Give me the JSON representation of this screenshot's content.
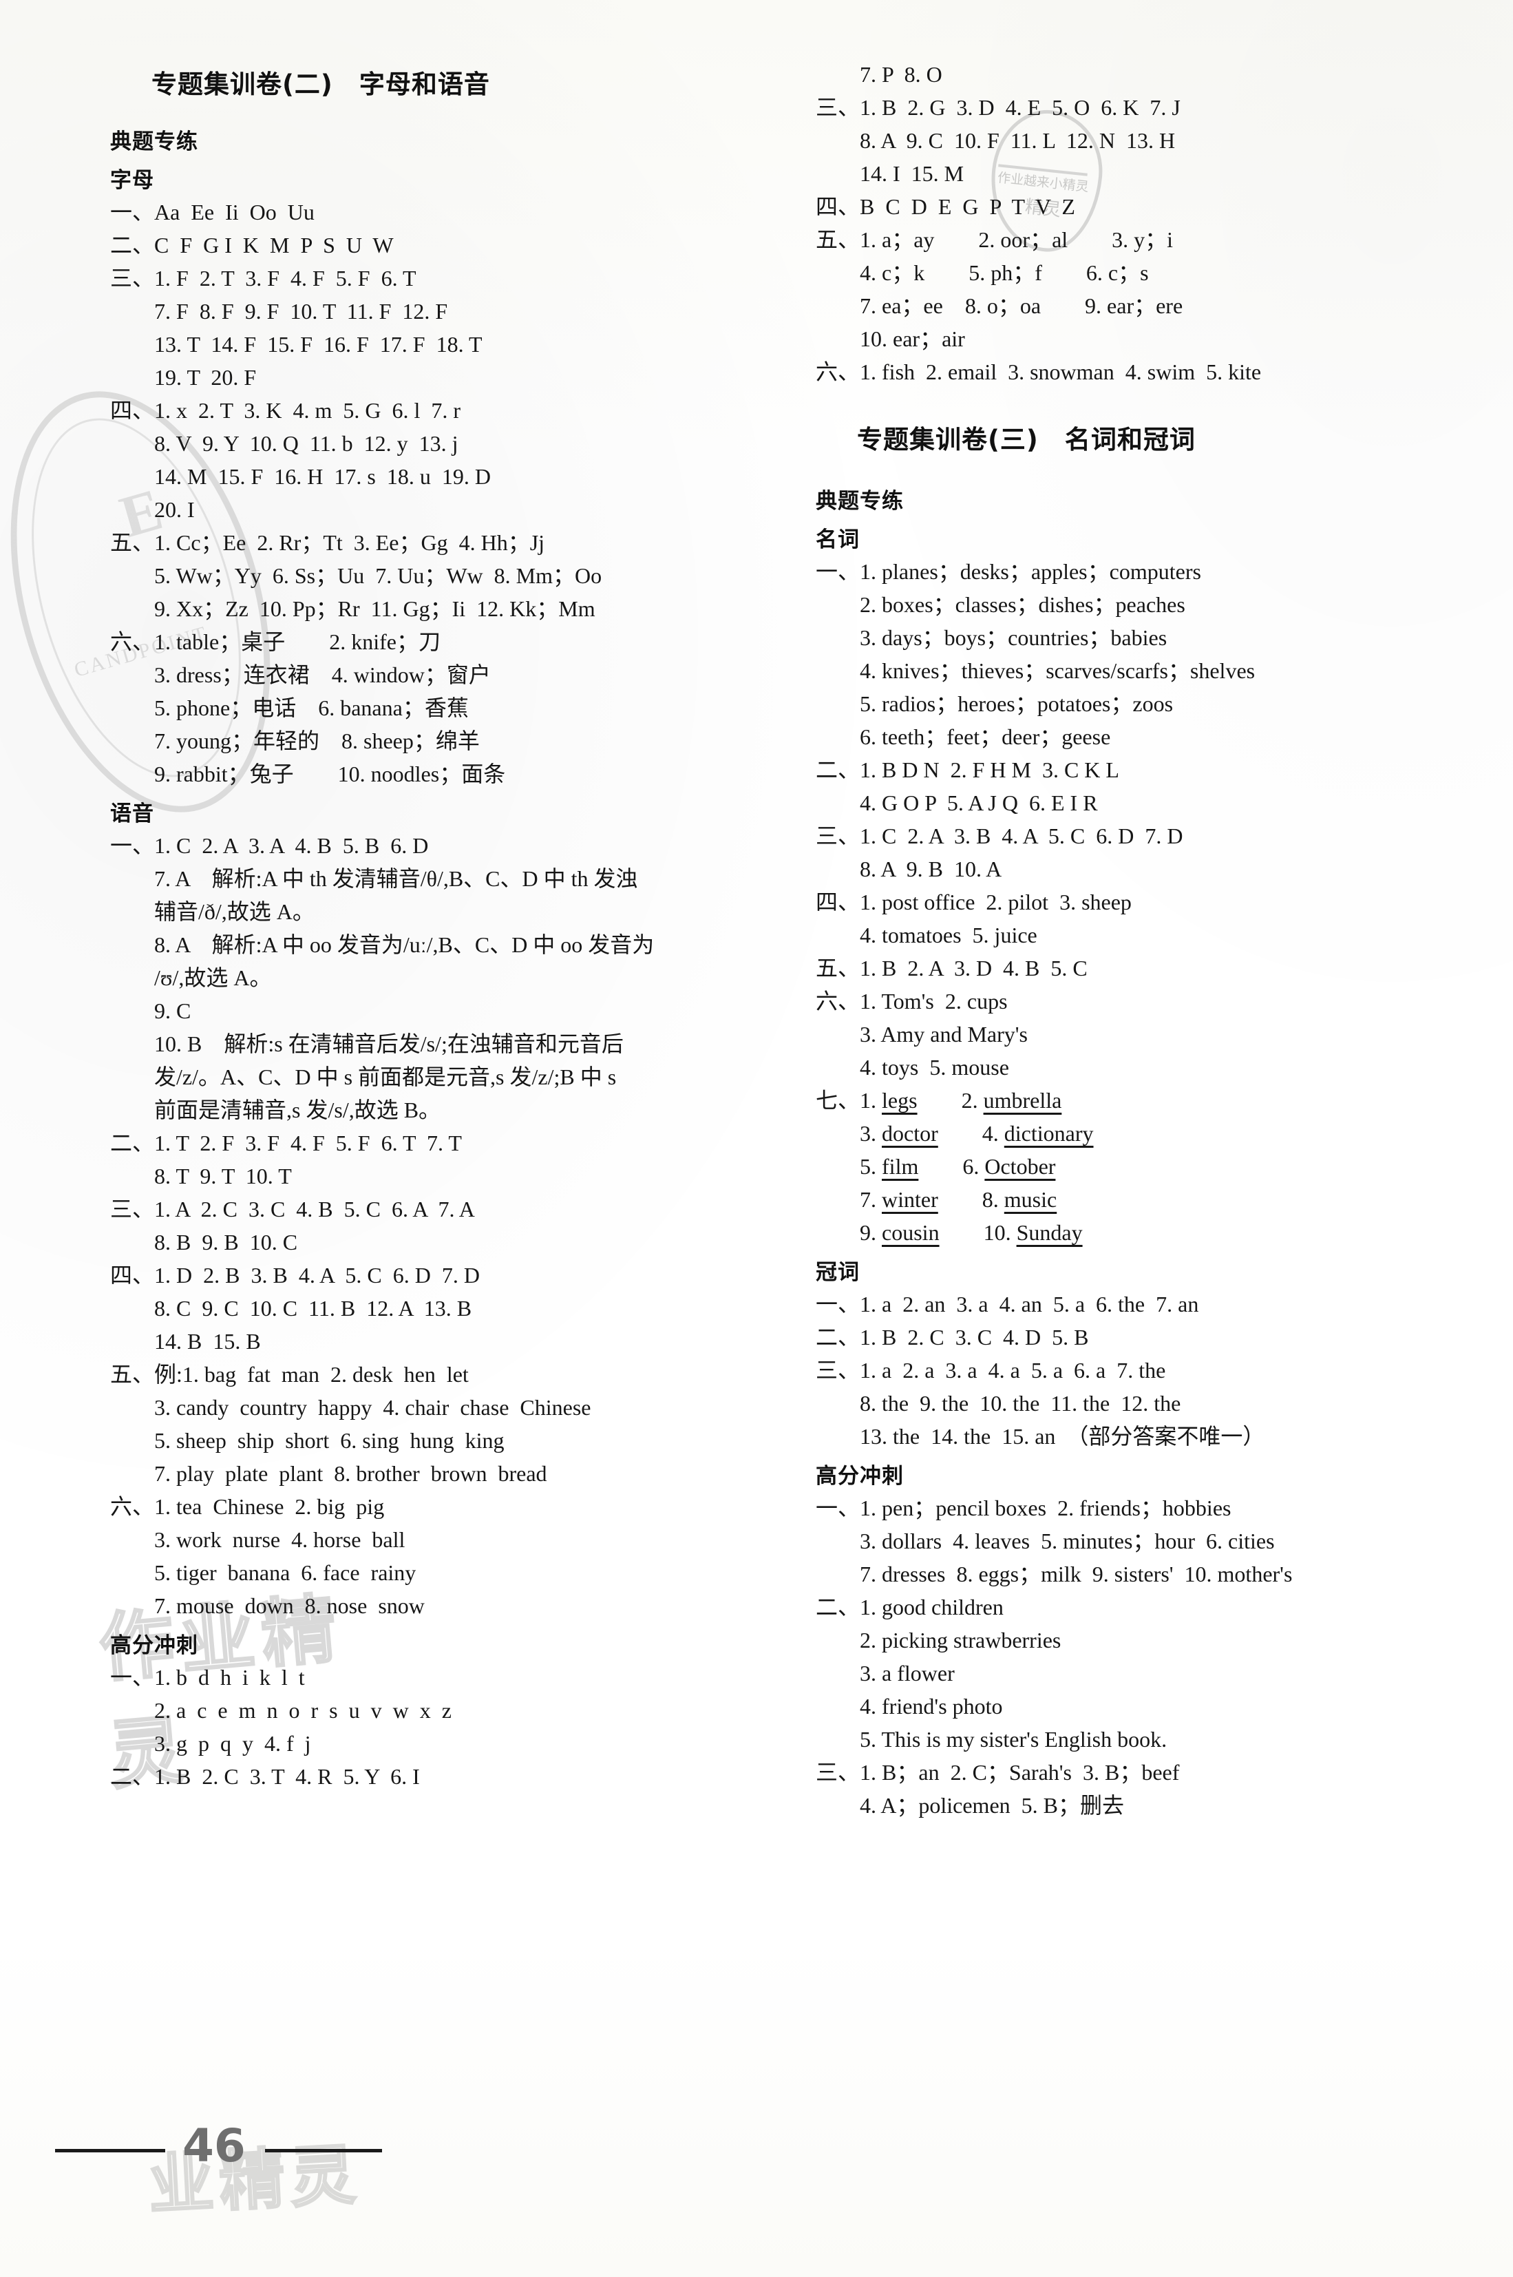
{
  "page": {
    "number": "46",
    "watermarks": {
      "left_stamp_big": "E",
      "left_stamp_small": "CANDPOINT",
      "center_text": "作业精灵",
      "right_stamp_line1": "作业越来小精灵",
      "right_stamp_line2": "精灵",
      "footer_text": "业精灵"
    }
  },
  "left_column": {
    "title": "专题集训卷(二)　字母和语音",
    "blocks": [
      {
        "type": "head",
        "text": "典题专练"
      },
      {
        "type": "head",
        "text": "字母"
      },
      {
        "type": "line",
        "num": "一、",
        "text": "Aa  Ee  Ii  Oo  Uu"
      },
      {
        "type": "line",
        "num": "二、",
        "text": "C  F  G I  K  M  P  S  U  W"
      },
      {
        "type": "line",
        "num": "三、",
        "text": "1. F  2. T  3. F  4. F  5. F  6. T"
      },
      {
        "type": "line",
        "num": "",
        "text": "7. F  8. F  9. F  10. T  11. F  12. F"
      },
      {
        "type": "line",
        "num": "",
        "text": "13. T  14. F  15. F  16. F  17. F  18. T"
      },
      {
        "type": "line",
        "num": "",
        "text": "19. T  20. F"
      },
      {
        "type": "line",
        "num": "四、",
        "text": "1. x  2. T  3. K  4. m  5. G  6. l  7. r"
      },
      {
        "type": "line",
        "num": "",
        "text": "8. V  9. Y  10. Q  11. b  12. y  13. j"
      },
      {
        "type": "line",
        "num": "",
        "text": "14. M  15. F  16. H  17. s  18. u  19. D"
      },
      {
        "type": "line",
        "num": "",
        "text": "20. I"
      },
      {
        "type": "line",
        "num": "五、",
        "text": "1. Cc；Ee  2. Rr；Tt  3. Ee；Gg  4. Hh；Jj"
      },
      {
        "type": "line",
        "num": "",
        "text": "5. Ww；Yy  6. Ss；Uu  7. Uu；Ww  8. Mm；Oo"
      },
      {
        "type": "line",
        "num": "",
        "text": "9. Xx；Zz  10. Pp；Rr  11. Gg；Ii  12. Kk；Mm"
      },
      {
        "type": "line",
        "num": "六、",
        "text": "1. table；桌子　　2. knife；刀"
      },
      {
        "type": "line",
        "num": "",
        "text": "3. dress；连衣裙　4. window；窗户"
      },
      {
        "type": "line",
        "num": "",
        "text": "5. phone；电话　6. banana；香蕉"
      },
      {
        "type": "line",
        "num": "",
        "text": "7. young；年轻的　8. sheep；绵羊"
      },
      {
        "type": "line",
        "num": "",
        "text": "9. rabbit；兔子　　10. noodles；面条"
      },
      {
        "type": "head",
        "text": "语音"
      },
      {
        "type": "line",
        "num": "一、",
        "text": "1. C  2. A  3. A  4. B  5. B  6. D"
      },
      {
        "type": "line",
        "num": "",
        "text": "7. A　解析:A 中 th 发清辅音/θ/,B、C、D 中 th 发浊"
      },
      {
        "type": "line",
        "num": "",
        "text": "辅音/ð/,故选 A。"
      },
      {
        "type": "line",
        "num": "",
        "text": "8. A　解析:A 中 oo 发音为/uː/,B、C、D 中 oo 发音为"
      },
      {
        "type": "line",
        "num": "",
        "text": "/ʊ/,故选 A。"
      },
      {
        "type": "line",
        "num": "",
        "text": "9. C"
      },
      {
        "type": "line",
        "num": "",
        "text": "10. B　解析:s 在清辅音后发/s/;在浊辅音和元音后"
      },
      {
        "type": "line",
        "num": "",
        "text": "发/z/。A、C、D 中 s 前面都是元音,s 发/z/;B 中 s"
      },
      {
        "type": "line",
        "num": "",
        "text": "前面是清辅音,s 发/s/,故选 B。"
      },
      {
        "type": "line",
        "num": "二、",
        "text": "1. T  2. F  3. F  4. F  5. F  6. T  7. T"
      },
      {
        "type": "line",
        "num": "",
        "text": "8. T  9. T  10. T"
      },
      {
        "type": "line",
        "num": "三、",
        "text": "1. A  2. C  3. C  4. B  5. C  6. A  7. A"
      },
      {
        "type": "line",
        "num": "",
        "text": "8. B  9. B  10. C"
      },
      {
        "type": "line",
        "num": "四、",
        "text": "1. D  2. B  3. B  4. A  5. C  6. D  7. D"
      },
      {
        "type": "line",
        "num": "",
        "text": "8. C  9. C  10. C  11. B  12. A  13. B"
      },
      {
        "type": "line",
        "num": "",
        "text": "14. B  15. B"
      },
      {
        "type": "line",
        "num": "五、",
        "text": "例:1. bag  fat  man  2. desk  hen  let"
      },
      {
        "type": "line",
        "num": "",
        "text": "3. candy  country  happy  4. chair  chase  Chinese"
      },
      {
        "type": "line",
        "num": "",
        "text": "5. sheep  ship  short  6. sing  hung  king"
      },
      {
        "type": "line",
        "num": "",
        "text": "7. play  plate  plant  8. brother  brown  bread"
      },
      {
        "type": "line",
        "num": "六、",
        "text": "1. tea  Chinese  2. big  pig"
      },
      {
        "type": "line",
        "num": "",
        "text": "3. work  nurse  4. horse  ball"
      },
      {
        "type": "line",
        "num": "",
        "text": "5. tiger  banana  6. face  rainy"
      },
      {
        "type": "line",
        "num": "",
        "text": "7. mouse  down  8. nose  snow"
      },
      {
        "type": "head",
        "text": "高分冲刺"
      },
      {
        "type": "line",
        "num": "一、",
        "text": "1. b  d  h  i  k  l  t"
      },
      {
        "type": "line",
        "num": "",
        "text": "2. a  c  e  m  n  o  r  s  u  v  w  x  z"
      },
      {
        "type": "line",
        "num": "",
        "text": "3. g  p  q  y  4. f  j"
      },
      {
        "type": "line",
        "num": "二、",
        "text": "1. B  2. C  3. T  4. R  5. Y  6. I"
      }
    ]
  },
  "right_column": {
    "title": "专题集训卷(三)　名词和冠词",
    "blocks_before_title": [
      {
        "type": "line",
        "num": "",
        "text": "7. P  8. O"
      },
      {
        "type": "line",
        "num": "三、",
        "text": "1. B  2. G  3. D  4. E  5. O  6. K  7. J"
      },
      {
        "type": "line",
        "num": "",
        "text": "8. A  9. C  10. F  11. L  12. N  13. H"
      },
      {
        "type": "line",
        "num": "",
        "text": "14. I  15. M"
      },
      {
        "type": "line",
        "num": "四、",
        "text": "B  C  D  E  G  P  T  V  Z"
      },
      {
        "type": "line",
        "num": "五、",
        "text": "1. a；ay　　2. oor；al　　3. y；i"
      },
      {
        "type": "line",
        "num": "",
        "text": "4. c；k　　5. ph；f　　6. c；s"
      },
      {
        "type": "line",
        "num": "",
        "text": "7. ea；ee　8. o；oa　　9. ear；ere"
      },
      {
        "type": "line",
        "num": "",
        "text": "10. ear；air"
      },
      {
        "type": "line",
        "num": "六、",
        "text": "1. fish  2. email  3. snowman  4. swim  5. kite"
      }
    ],
    "blocks_after_title": [
      {
        "type": "head",
        "text": "典题专练"
      },
      {
        "type": "head",
        "text": "名词"
      },
      {
        "type": "line",
        "num": "一、",
        "text": "1. planes；desks；apples；computers"
      },
      {
        "type": "line",
        "num": "",
        "text": "2. boxes；classes；dishes；peaches"
      },
      {
        "type": "line",
        "num": "",
        "text": "3. days；boys；countries；babies"
      },
      {
        "type": "line",
        "num": "",
        "text": "4. knives；thieves；scarves/scarfs；shelves"
      },
      {
        "type": "line",
        "num": "",
        "text": "5. radios；heroes；potatoes；zoos"
      },
      {
        "type": "line",
        "num": "",
        "text": "6. teeth；feet；deer；geese"
      },
      {
        "type": "line",
        "num": "二、",
        "text": "1. B D N  2. F H M  3. C K L"
      },
      {
        "type": "line",
        "num": "",
        "text": "4. G O P  5. A J Q  6. E I R"
      },
      {
        "type": "line",
        "num": "三、",
        "text": "1. C  2. A  3. B  4. A  5. C  6. D  7. D"
      },
      {
        "type": "line",
        "num": "",
        "text": "8. A  9. B  10. A"
      },
      {
        "type": "line",
        "num": "四、",
        "text": "1. post office  2. pilot  3. sheep"
      },
      {
        "type": "line",
        "num": "",
        "text": "4. tomatoes  5. juice"
      },
      {
        "type": "line",
        "num": "五、",
        "text": "1. B  2. A  3. D  4. B  5. C"
      },
      {
        "type": "line",
        "num": "六、",
        "text": "1. Tom's  2. cups"
      },
      {
        "type": "line",
        "num": "",
        "text": "3. Amy and Mary's"
      },
      {
        "type": "line",
        "num": "",
        "text": "4. toys  5. mouse"
      },
      {
        "type": "line_ul",
        "num": "七、",
        "pre": "1. ",
        "u1": "legs",
        "mid": "　　2. ",
        "u2": "umbrella"
      },
      {
        "type": "line_ul",
        "num": "",
        "pre": "3. ",
        "u1": "doctor",
        "mid": "　　4. ",
        "u2": "dictionary"
      },
      {
        "type": "line_ul",
        "num": "",
        "pre": "5. ",
        "u1": "film",
        "mid": "　　6. ",
        "u2": "October"
      },
      {
        "type": "line_ul",
        "num": "",
        "pre": "7. ",
        "u1": "winter",
        "mid": "　　8. ",
        "u2": "music"
      },
      {
        "type": "line_ul",
        "num": "",
        "pre": "9. ",
        "u1": "cousin",
        "mid": "　　10. ",
        "u2": "Sunday"
      },
      {
        "type": "head",
        "text": "冠词"
      },
      {
        "type": "line",
        "num": "一、",
        "text": "1. a  2. an  3. a  4. an  5. a  6. the  7. an"
      },
      {
        "type": "line",
        "num": "二、",
        "text": "1. B  2. C  3. C  4. D  5. B"
      },
      {
        "type": "line",
        "num": "三、",
        "text": "1. a  2. a  3. a  4. a  5. a  6. a  7. the"
      },
      {
        "type": "line",
        "num": "",
        "text": "8. the  9. the  10. the  11. the  12. the"
      },
      {
        "type": "line",
        "num": "",
        "text": "13. the  14. the  15. an　（部分答案不唯一）"
      },
      {
        "type": "head",
        "text": "高分冲刺"
      },
      {
        "type": "line",
        "num": "一、",
        "text": "1. pen；pencil boxes  2. friends；hobbies"
      },
      {
        "type": "line",
        "num": "",
        "text": "3. dollars  4. leaves  5. minutes；hour  6. cities"
      },
      {
        "type": "line",
        "num": "",
        "text": "7. dresses  8. eggs；milk  9. sisters'  10. mother's"
      },
      {
        "type": "line",
        "num": "二、",
        "text": "1. good children"
      },
      {
        "type": "line",
        "num": "",
        "text": "2. picking strawberries"
      },
      {
        "type": "line",
        "num": "",
        "text": "3. a flower"
      },
      {
        "type": "line",
        "num": "",
        "text": "4. friend's photo"
      },
      {
        "type": "line",
        "num": "",
        "text": "5. This is my sister's English book."
      },
      {
        "type": "line",
        "num": "三、",
        "text": "1. B；an  2. C；Sarah's  3. B；beef"
      },
      {
        "type": "line",
        "num": "",
        "text": "4. A；policemen  5. B；删去"
      }
    ]
  }
}
